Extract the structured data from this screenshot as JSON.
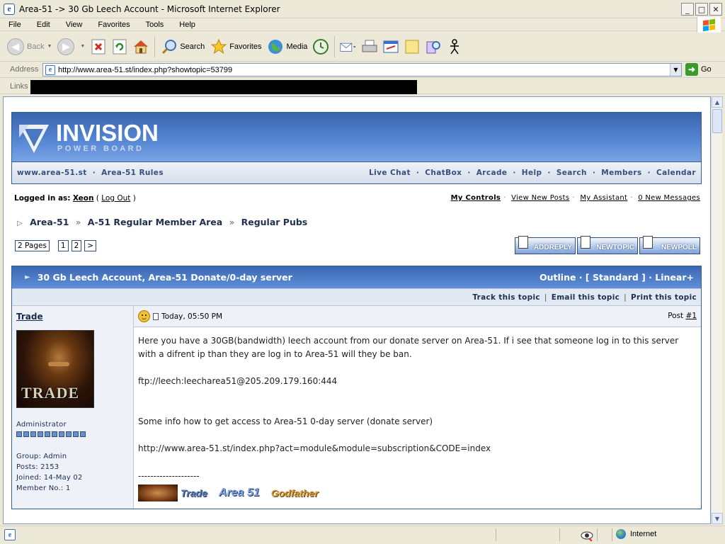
{
  "window": {
    "title": "Area-51 -> 30 Gb Leech Account - Microsoft Internet Explorer",
    "buttons": [
      "_",
      "□",
      "✕"
    ]
  },
  "menubar": [
    "File",
    "Edit",
    "View",
    "Favorites",
    "Tools",
    "Help"
  ],
  "toolbar": {
    "back_label": "Back",
    "search_label": "Search",
    "favorites_label": "Favorites",
    "media_label": "Media"
  },
  "address": {
    "label": "Address",
    "url": "http://www.area-51.st/index.php?showtopic=53799",
    "go_label": "Go"
  },
  "links": {
    "label": "Links"
  },
  "forum": {
    "logo_line1": "INVISION",
    "logo_line2": "POWER BOARD",
    "nav_left": [
      "www.area-51.st",
      "Area-51 Rules"
    ],
    "nav_right": [
      "Live Chat",
      "ChatBox",
      "Arcade",
      "Help",
      "Search",
      "Members",
      "Calendar"
    ],
    "logged_in_prefix": "Logged in as:",
    "username": "Xeon",
    "logout": "Log Out",
    "user_links": [
      "My Controls",
      "View New Posts",
      "My Assistant",
      "0 New Messages"
    ],
    "breadcrumb": [
      "Area-51",
      "A-51 Regular Member Area",
      "Regular Pubs"
    ],
    "pages_label": "2 Pages",
    "page_links": [
      "1",
      "2",
      ">"
    ],
    "post_buttons": [
      "ADDREPLY",
      "NEWTOPIC",
      "NEWPOLL"
    ],
    "topic_title": "30 Gb Leech Account, Area-51 Donate/0-day server",
    "view_modes": "Outline · [ Standard ] · Linear+",
    "topic_actions": [
      "Track this topic",
      "Email this topic",
      "Print this topic"
    ],
    "post": {
      "author": "Trade",
      "avatar_text": "TRADE",
      "role": "Administrator",
      "pips": 10,
      "group": "Group: Admin",
      "posts": "Posts: 2153",
      "joined": "Joined: 14-May 02",
      "member_no": "Member No.: 1",
      "timestamp": "Today, 05:50 PM",
      "post_label": "Post",
      "post_number": "#1",
      "body_line1": "Here you have a 30GB(bandwidth) leech account from our donate server on Area-51. If i see that someone log in to this server with a difrent ip than they are log in to Area-51 will they be ban.",
      "body_ftp": "ftp://leech:leecharea51@205.209.179.160:444",
      "body_info": "Some info how to get access to Area-51 0-day server (donate server)",
      "body_link": "http://www.area-51.st/index.php?act=module&module=subscription&CODE=index",
      "sig_rule": "--------------------",
      "sig_words": [
        "Trade",
        "Area 51",
        "Godfather"
      ]
    }
  },
  "status": {
    "zone": "Internet"
  }
}
